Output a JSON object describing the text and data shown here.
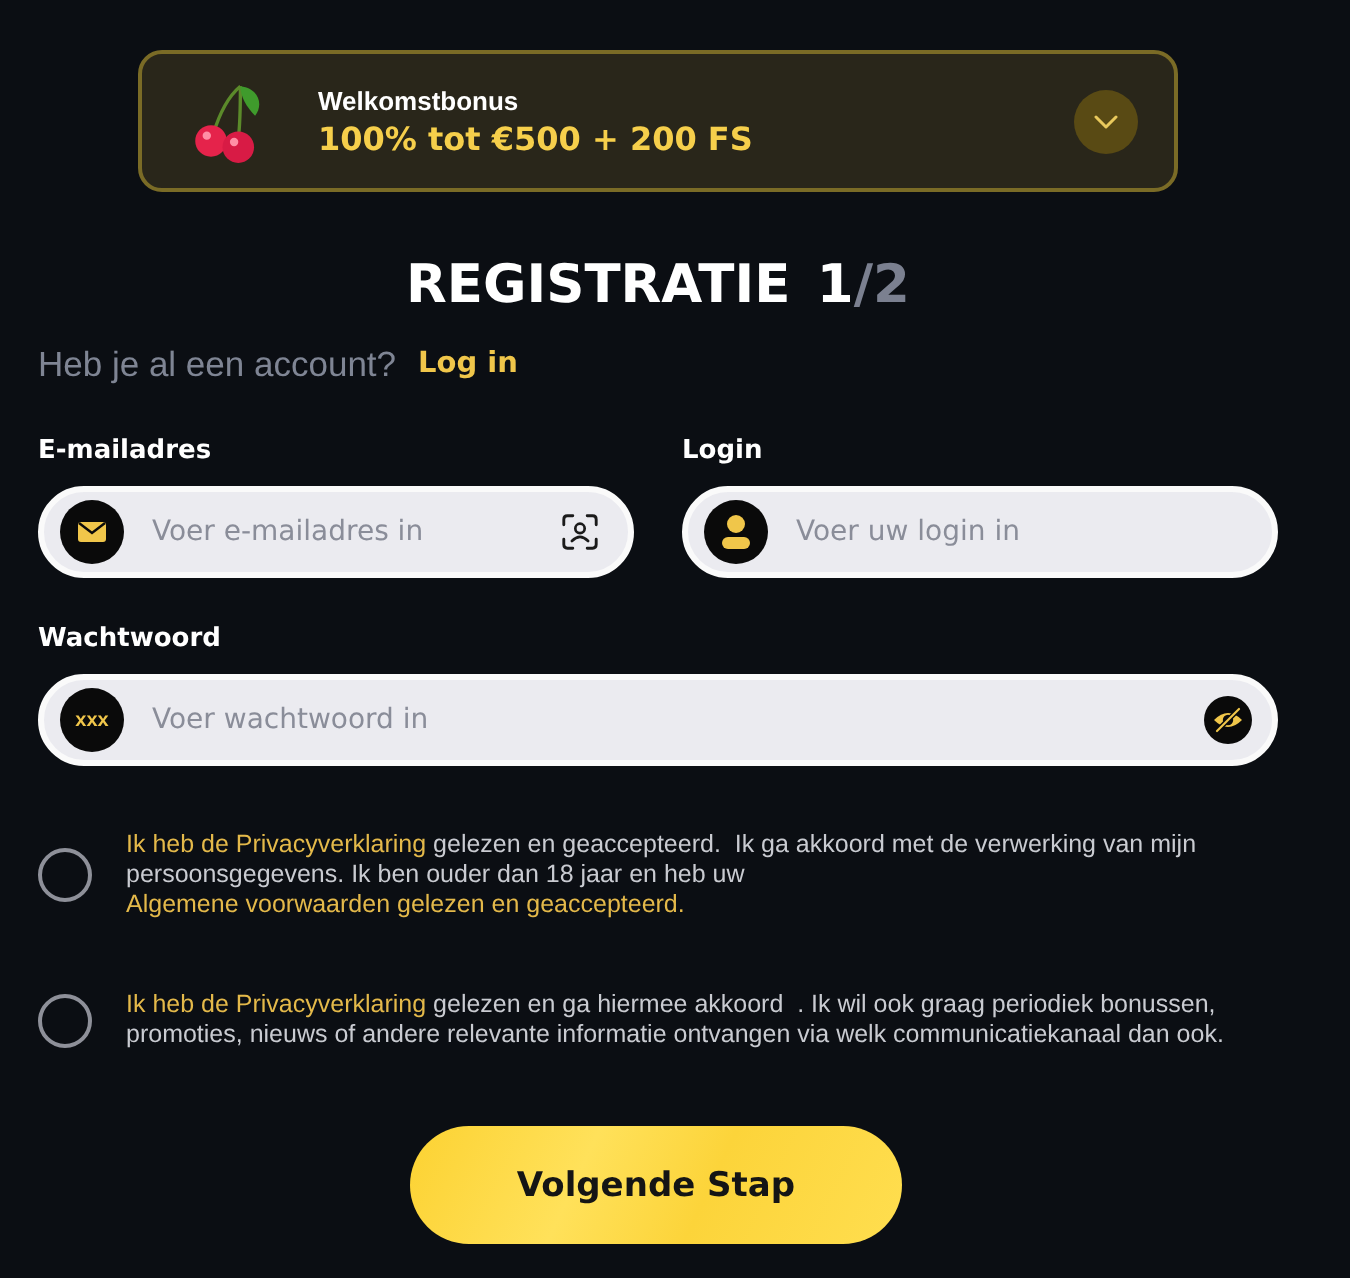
{
  "bonus": {
    "label": "Welkomstbonus",
    "offer": "100% tot €500 + 200 FS",
    "expanded": false
  },
  "heading": {
    "title": "REGISTRATIE",
    "step": "1",
    "rest": "/2"
  },
  "account_prompt": {
    "text": "Heb je al een account?",
    "link": "Log in"
  },
  "fields": [
    {
      "kind": "email",
      "label": "E-mailadres",
      "placeholder": "Voer e-mailadres in"
    },
    {
      "kind": "login",
      "label": "Login",
      "placeholder": "Voer uw login in"
    },
    {
      "kind": "password",
      "label": "Wachtwoord",
      "placeholder": "Voer wachtwoord in",
      "icon_text": "xxx"
    }
  ],
  "consents": [
    {
      "checked": false,
      "parts": [
        {
          "kind": "link",
          "text": "Ik heb de Privacyverklaring"
        },
        {
          "kind": "text",
          "text": " gelezen en geaccepteerd.  Ik ga akkoord met de verwerking van mijn persoonsgegevens. Ik ben ouder dan 18 jaar en heb uw  "
        },
        {
          "kind": "link",
          "text": "Algemene voorwaarden gelezen en geaccepteerd."
        }
      ]
    },
    {
      "checked": false,
      "parts": [
        {
          "kind": "link",
          "text": "Ik heb de Privacyverklaring"
        },
        {
          "kind": "text",
          "text": " gelezen en ga hiermee akkoord  . Ik wil ook graag periodiek bonussen, promoties, nieuws of andere relevante informatie ontvangen via welk communicatiekanaal dan ook."
        }
      ]
    }
  ],
  "submit": {
    "label": "Volgende Stap"
  }
}
